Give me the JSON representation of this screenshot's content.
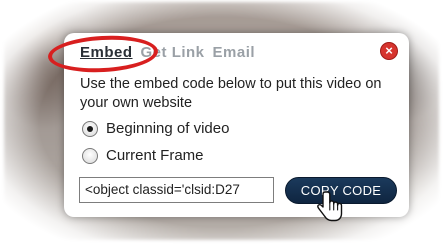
{
  "dialog": {
    "tabs": [
      {
        "label": "Embed",
        "active": true
      },
      {
        "label": "Get Link",
        "active": false
      },
      {
        "label": "Email",
        "active": false
      }
    ],
    "close_icon": "close-icon",
    "close_glyph": "×",
    "description": "Use the embed code below to put this video on your own website",
    "options": [
      {
        "label": "Beginning of video",
        "selected": true
      },
      {
        "label": "Current Frame",
        "selected": false
      }
    ],
    "embed_code_value": "<object classid='clsid:D27",
    "copy_button_label": "COPY CODE"
  },
  "colors": {
    "highlight": "#d81f1f",
    "copy_button": "#0f2540",
    "close_button": "#d6342e",
    "active_tab": "#2a2f36",
    "inactive_tab": "#9aa0a6"
  },
  "icons": {
    "close": "close-icon",
    "cursor": "hand-cursor-icon"
  }
}
